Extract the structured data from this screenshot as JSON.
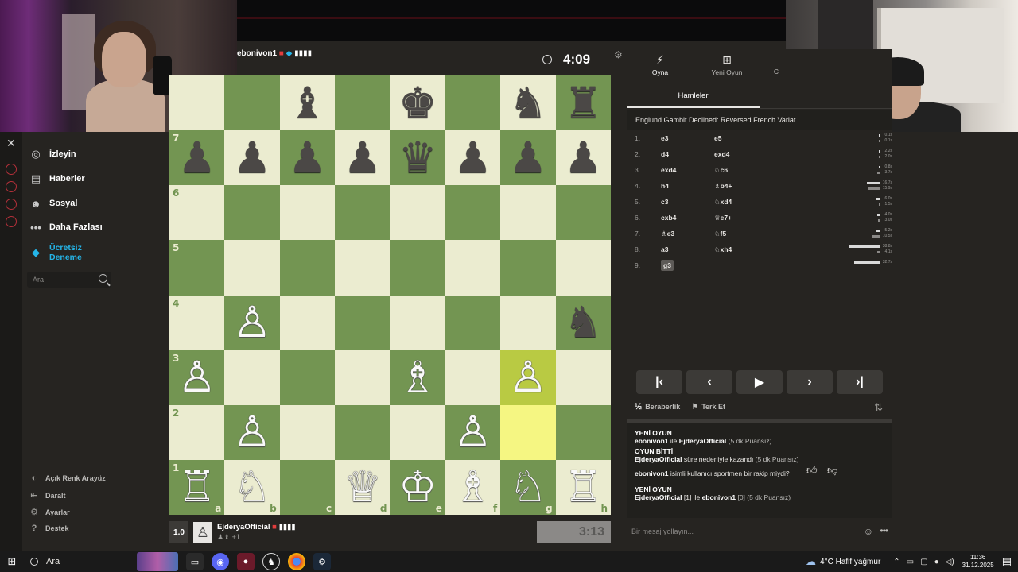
{
  "sidebar": {
    "items": [
      {
        "label": "İzleyin",
        "icon": "binoculars-icon"
      },
      {
        "label": "Haberler",
        "icon": "news-icon"
      },
      {
        "label": "Sosyal",
        "icon": "people-icon"
      },
      {
        "label": "Daha Fazlası",
        "icon": "more-dots-icon"
      }
    ],
    "trial_label": "Ücretsiz Deneme",
    "search_placeholder": "Ara",
    "bottom": [
      {
        "label": "Açık Renk Arayüz",
        "icon": "theme-icon"
      },
      {
        "label": "Daralt",
        "icon": "collapse-icon"
      },
      {
        "label": "Ayarlar",
        "icon": "gear-icon"
      },
      {
        "label": "Destek",
        "icon": "help-icon"
      }
    ]
  },
  "game": {
    "top_player": "ebonivon1",
    "top_clock": "4:09",
    "bottom_player": "EjderyaOfficial",
    "bottom_rating": "1.0",
    "bottom_captured": "+1",
    "bottom_clock": "3:13",
    "board_ranks": [
      "7",
      "6",
      "5",
      "4",
      "3",
      "2",
      "1"
    ],
    "board_files": [
      "a",
      "b",
      "c",
      "d",
      "e",
      "f",
      "g",
      "h"
    ]
  },
  "panel": {
    "tabs": [
      {
        "label": "Oyna",
        "icon": "lightning-icon"
      },
      {
        "label": "Yeni Oyun",
        "icon": "plus-icon"
      },
      {
        "label": "C",
        "icon": "partial-icon"
      }
    ],
    "subtab": "Hamleler",
    "opening": "Englund Gambit Declined: Reversed French Variat",
    "moves": [
      {
        "n": "1.",
        "w": "e3",
        "b": "e5",
        "tw": "0.1s",
        "tb": "0.1s"
      },
      {
        "n": "2.",
        "w": "d4",
        "b": "exd4",
        "tw": "2.2s",
        "tb": "2.0s"
      },
      {
        "n": "3.",
        "w": "exd4",
        "b": "♘c6",
        "tw": "0.8s",
        "tb": "3.7s"
      },
      {
        "n": "4.",
        "w": "h4",
        "b": "♗b4+",
        "tw": "16.7s",
        "tb": "15.9s"
      },
      {
        "n": "5.",
        "w": "c3",
        "b": "♘xd4",
        "tw": "6.0s",
        "tb": "1.5s"
      },
      {
        "n": "6.",
        "w": "cxb4",
        "b": "♕e7+",
        "tw": "4.0s",
        "tb": "3.0s"
      },
      {
        "n": "7.",
        "w": "♗e3",
        "b": "♘f5",
        "tw": "5.2s",
        "tb": "10.5s"
      },
      {
        "n": "8.",
        "w": "a3",
        "b": "♘xh4",
        "tw": "38.8s",
        "tb": "4.1s"
      },
      {
        "n": "9.",
        "w": "g3",
        "b": "",
        "tw": "32.7s",
        "tb": ""
      }
    ],
    "draw_label": "Beraberlik",
    "resign_label": "Terk Et",
    "chat": [
      {
        "title": "YENİ OYUN",
        "p1": "ebonivon1",
        "mid": " ile ",
        "p2": "EjderyaOfficial",
        "tail": " (5 dk Puansız)"
      },
      {
        "title": "OYUN BİTTİ",
        "p1": "EjderyaOfficial",
        "mid": " süre nedeniyle kazandı",
        "p2": "",
        "tail": " (5 dk Puansız)"
      },
      {
        "title": "",
        "p1": "ebonivon1",
        "mid": " isimli kullanıcı sportmen bir rakip miydi?",
        "p2": "",
        "tail": ""
      },
      {
        "title": "YENİ OYUN",
        "p1": "EjderyaOfficial",
        "mid": " [1] ile ",
        "p2": "ebonivon1",
        "tail": " [0] (5 dk Puansız)"
      }
    ],
    "message_placeholder": "Bir mesaj yollayın..."
  },
  "taskbar": {
    "search": "Ara",
    "weather": "4°C  Hafif yağmur",
    "time": "11:36",
    "date": "31.12.2025"
  }
}
